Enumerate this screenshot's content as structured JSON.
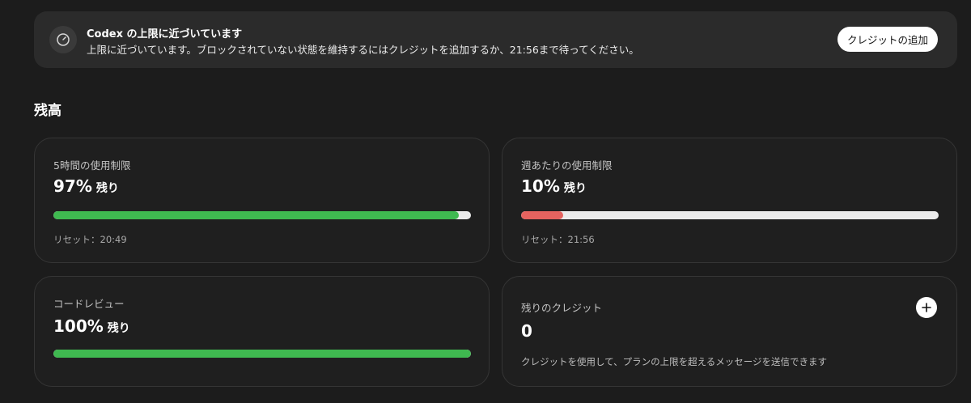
{
  "banner": {
    "icon": "speedometer-icon",
    "title": "Codex の上限に近づいています",
    "message": "上限に近づいています。ブロックされていない状態を維持するにはクレジットを追加するか、21:56まで待ってください。",
    "button_label": "クレジットの追加"
  },
  "balance": {
    "section_title": "残高",
    "five_hour": {
      "label": "5時間の使用制限",
      "value": "97%",
      "unit": "残り",
      "percent_remaining": 97,
      "bar_color": "#3fb950",
      "reset": "リセット：20:49"
    },
    "weekly": {
      "label": "週あたりの使用制限",
      "value": "10%",
      "unit": "残り",
      "percent_remaining": 10,
      "bar_color": "#e5635f",
      "reset": "リセット：21:56"
    },
    "code_review": {
      "label": "コードレビュー",
      "value": "100%",
      "unit": "残り",
      "percent_remaining": 100,
      "bar_color": "#3fb950"
    },
    "credits": {
      "label": "残りのクレジット",
      "value": "0",
      "add_icon": "plus-icon",
      "note": "クレジットを使用して、プランの上限を超えるメッセージを送信できます"
    }
  },
  "colors": {
    "background": "#1c1c1c",
    "banner_background": "#2b2b2b",
    "card_border": "#353535",
    "bar_track": "#ebebeb"
  }
}
